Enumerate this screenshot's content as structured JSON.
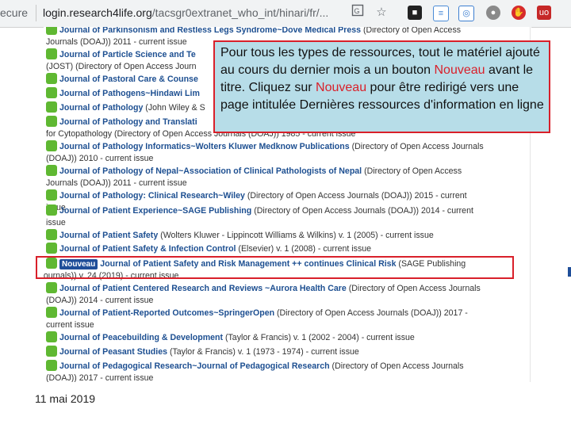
{
  "browser": {
    "secure_label": "ecure",
    "url_host": "login.research4life.org",
    "url_path": "/tacsgr0extranet_who_int/hinari/fr/..."
  },
  "icons": {
    "translate": "translate-icon",
    "bookmark": "star-icon",
    "extensions": [
      "notion-icon",
      "document-icon",
      "vpn-icon",
      "circle-icon",
      "shield-icon",
      "ublock-icon"
    ]
  },
  "colors": {
    "new_badge": "#1f4e99",
    "highlight_red": "#d9202a",
    "callout_bg": "#b7dde8",
    "oa_square": "#5fb832"
  },
  "journals": [
    {
      "title": "Journal of Parkinsonism and Restless Legs Syndrome~Dove Medical Press",
      "meta": " (Directory of Open Access",
      "line2": "Journals (DOAJ)) 2011 - current issue"
    },
    {
      "title": "Journal of Particle Science and Te",
      "meta": "",
      "line2": "(JOST) (Directory of Open Access Journ"
    },
    {
      "title": "Journal of Pastoral Care & Counse",
      "meta": "",
      "line2": ""
    },
    {
      "title": "Journal of Pathogens~Hindawi Lim",
      "meta": "",
      "line2": ""
    },
    {
      "title": "Journal of Pathology",
      "meta": " (John Wiley & S",
      "line2": ""
    },
    {
      "title": "Journal of Pathology and Translati",
      "meta": "",
      "line2": "for Cytopathology (Directory of Open Access Journals (DOAJ)) 1985 - current issue"
    },
    {
      "title": "Journal of Pathology Informatics~Wolters Kluwer Medknow Publications",
      "meta": " (Directory of Open Access Journals",
      "line2": "(DOAJ)) 2010 - current issue"
    },
    {
      "title": "Journal of Pathology of Nepal~Association of Clinical Pathologists of Nepal",
      "meta": " (Directory of Open Access",
      "line2": "Journals (DOAJ)) 2011 - current issue"
    },
    {
      "title": "Journal of Pathology: Clinical Research~Wiley",
      "meta": " (Directory of Open Access Journals (DOAJ)) 2015 - current",
      "line2": "issue"
    },
    {
      "title": "Journal of Patient Experience~SAGE Publishing",
      "meta": " (Directory of Open Access Journals (DOAJ)) 2014 - current",
      "line2": "issue"
    },
    {
      "title": "Journal of Patient Safety",
      "meta": " (Wolters Kluwer - Lippincott Williams & Wilkins) v. 1 (2005) - current issue",
      "line2": ""
    },
    {
      "title": "Journal of Patient Safety & Infection Control",
      "meta": " (Elsevier) v. 1 (2008) - current issue",
      "line2": ""
    },
    {
      "badge": "Nouveau",
      "title": "Journal of Patient Safety and Risk Management ++ continues Clinical Risk",
      "meta": " (SAGE Publishing",
      "line2": "(Journals)) v. 24 (2019) - current issue"
    },
    {
      "title": "Journal of Patient Centered Research and Reviews ~Aurora Health Care",
      "meta": " (Directory of Open Access Journals",
      "line2": "(DOAJ)) 2014 - current issue"
    },
    {
      "title": "Journal of Patient-Reported Outcomes~SpringerOpen",
      "meta": " (Directory of Open Access Journals (DOAJ)) 2017 -",
      "line2": "current issue"
    },
    {
      "title": "Journal of Peacebuilding & Development",
      "meta": " (Taylor & Francis) v. 1 (2002 - 2004) - current issue",
      "line2": ""
    },
    {
      "title": "Journal of Peasant Studies",
      "meta": " (Taylor & Francis) v. 1 (1973 - 1974) - current issue",
      "line2": ""
    },
    {
      "title": "Journal of Pedagogical Research~Journal of Pedagogical Research",
      "meta": " (Directory of Open Access Journals",
      "line2": "(DOAJ)) 2017 - current issue"
    }
  ],
  "callout": {
    "part1": "Pour tous les types de ressources, tout le matériel ajouté au cours du dernier mois a un bouton ",
    "nouveau1": "Nouveau",
    "part2": " avant le titre.  Cliquez sur ",
    "nouveau2": "Nouveau",
    "part3": " pour être redirigé vers une page intitulée Dernières ressources d'information en ligne"
  },
  "footer": {
    "date": "11 mai 2019"
  }
}
